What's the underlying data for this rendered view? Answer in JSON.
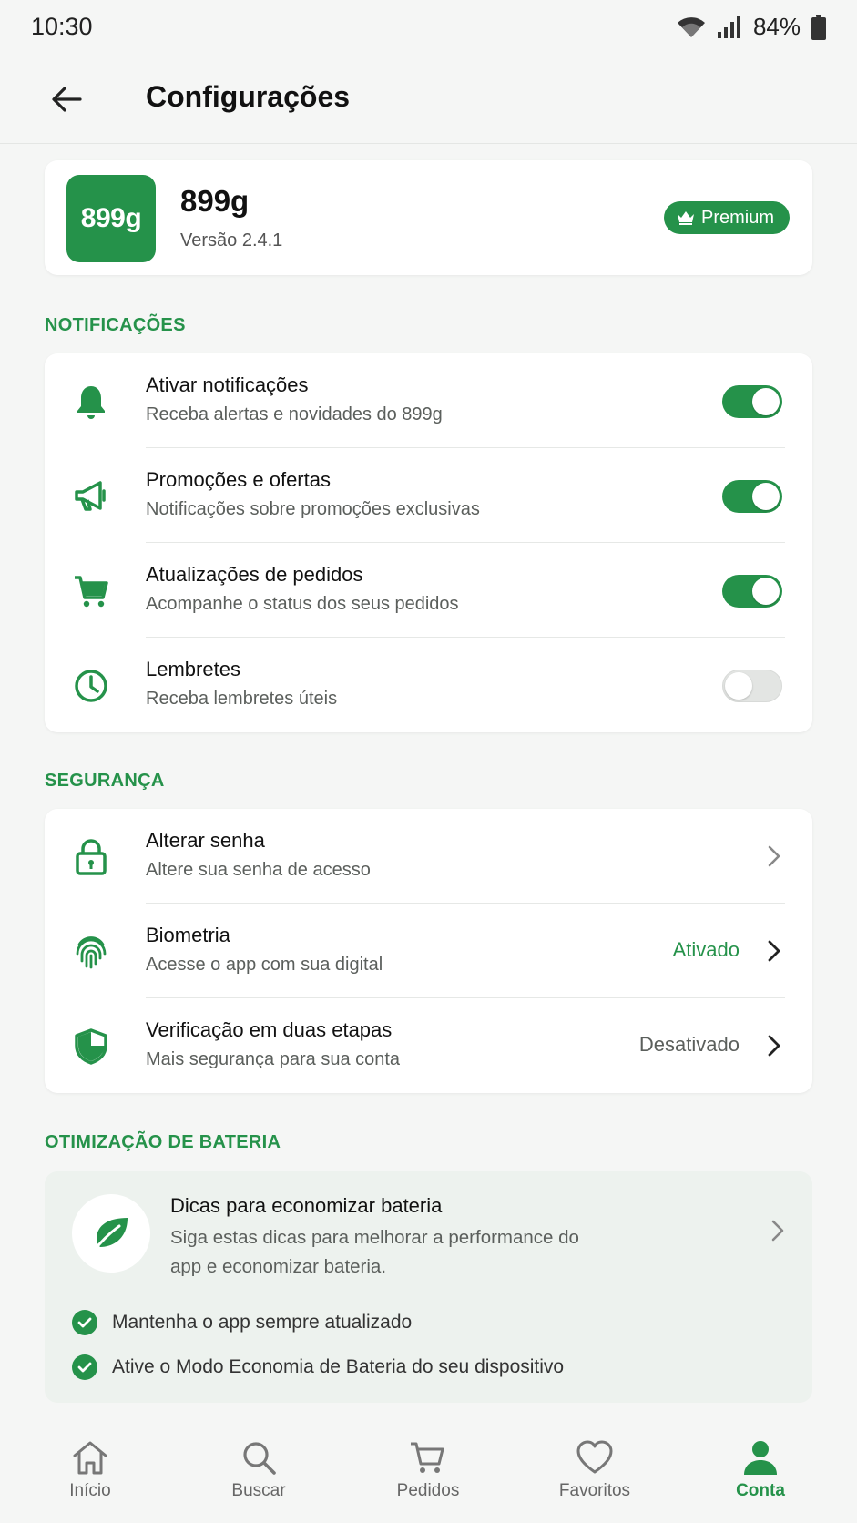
{
  "status_bar": {
    "time": "10:30",
    "battery": "84%"
  },
  "header": {
    "title": "Configurações"
  },
  "app_card": {
    "logo_text": "899g",
    "name": "899g",
    "version": "Versão 2.4.1",
    "badge": "Premium"
  },
  "notifications": {
    "section_title": "NOTIFICAÇÕES",
    "items": [
      {
        "title": "Ativar notificações",
        "subtitle": "Receba alertas e novidades do 899g",
        "icon": "bell-icon",
        "enabled": true
      },
      {
        "title": "Promoções e ofertas",
        "subtitle": "Notificações sobre promoções exclusivas",
        "icon": "megaphone-icon",
        "enabled": true
      },
      {
        "title": "Atualizações de pedidos",
        "subtitle": "Acompanhe o status dos seus pedidos",
        "icon": "cart-icon",
        "enabled": true
      },
      {
        "title": "Lembretes",
        "subtitle": "Receba lembretes úteis",
        "icon": "clock-icon",
        "enabled": false
      }
    ]
  },
  "security": {
    "section_title": "SEGURANÇA",
    "items": [
      {
        "title": "Alterar senha",
        "subtitle": "Altere sua senha de acesso",
        "icon": "lock-icon",
        "value": ""
      },
      {
        "title": "Biometria",
        "subtitle": "Acesse o app com sua digital",
        "icon": "fingerprint-icon",
        "value": "Ativado"
      },
      {
        "title": "Verificação em duas etapas",
        "subtitle": "Mais segurança para sua conta",
        "icon": "shield-icon",
        "value": "Desativado"
      }
    ]
  },
  "battery": {
    "section_title": "OTIMIZAÇÃO DE BATERIA",
    "title": "Dicas para economizar bateria",
    "description": "Siga estas dicas para melhorar a performance do app e economizar bateria.",
    "tips": [
      "Mantenha o app sempre atualizado",
      "Ative o Modo Economia de Bateria do seu dispositivo"
    ]
  },
  "bottom_nav": {
    "items": [
      {
        "label": "Início",
        "icon": "home-icon"
      },
      {
        "label": "Buscar",
        "icon": "search-icon"
      },
      {
        "label": "Pedidos",
        "icon": "cart-icon"
      },
      {
        "label": "Favoritos",
        "icon": "heart-icon"
      },
      {
        "label": "Conta",
        "icon": "user-icon",
        "active": true
      }
    ]
  },
  "colors": {
    "accent": "#25924a",
    "background": "#f5f6f5",
    "card": "#ffffff",
    "battery_card": "#edf2ee"
  }
}
